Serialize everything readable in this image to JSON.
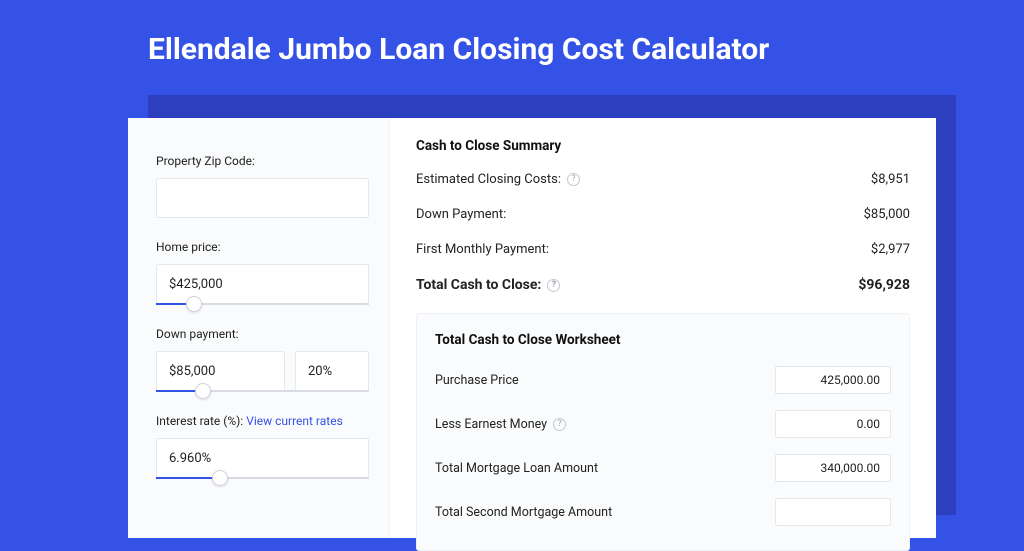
{
  "page": {
    "title": "Ellendale Jumbo Loan Closing Cost Calculator"
  },
  "form": {
    "zip": {
      "label": "Property Zip Code:",
      "value": ""
    },
    "price": {
      "label": "Home price:",
      "value": "$425,000",
      "fill_pct": 18
    },
    "down": {
      "label": "Down payment:",
      "value": "$85,000",
      "pct": "20%",
      "fill_pct": 22
    },
    "rate": {
      "label": "Interest rate (%):",
      "link": "View current rates",
      "value": "6.960%",
      "fill_pct": 30
    }
  },
  "summary": {
    "title": "Cash to Close Summary",
    "rows": [
      {
        "label": "Estimated Closing Costs:",
        "help": true,
        "value": "$8,951"
      },
      {
        "label": "Down Payment:",
        "help": false,
        "value": "$85,000"
      },
      {
        "label": "First Monthly Payment:",
        "help": false,
        "value": "$2,977"
      }
    ],
    "total": {
      "label": "Total Cash to Close:",
      "help": true,
      "value": "$96,928"
    }
  },
  "worksheet": {
    "title": "Total Cash to Close Worksheet",
    "rows": [
      {
        "label": "Purchase Price",
        "help": false,
        "value": "425,000.00"
      },
      {
        "label": "Less Earnest Money",
        "help": true,
        "value": "0.00"
      },
      {
        "label": "Total Mortgage Loan Amount",
        "help": false,
        "value": "340,000.00"
      },
      {
        "label": "Total Second Mortgage Amount",
        "help": false,
        "value": ""
      }
    ]
  },
  "colors": {
    "accent": "#3452e6"
  }
}
